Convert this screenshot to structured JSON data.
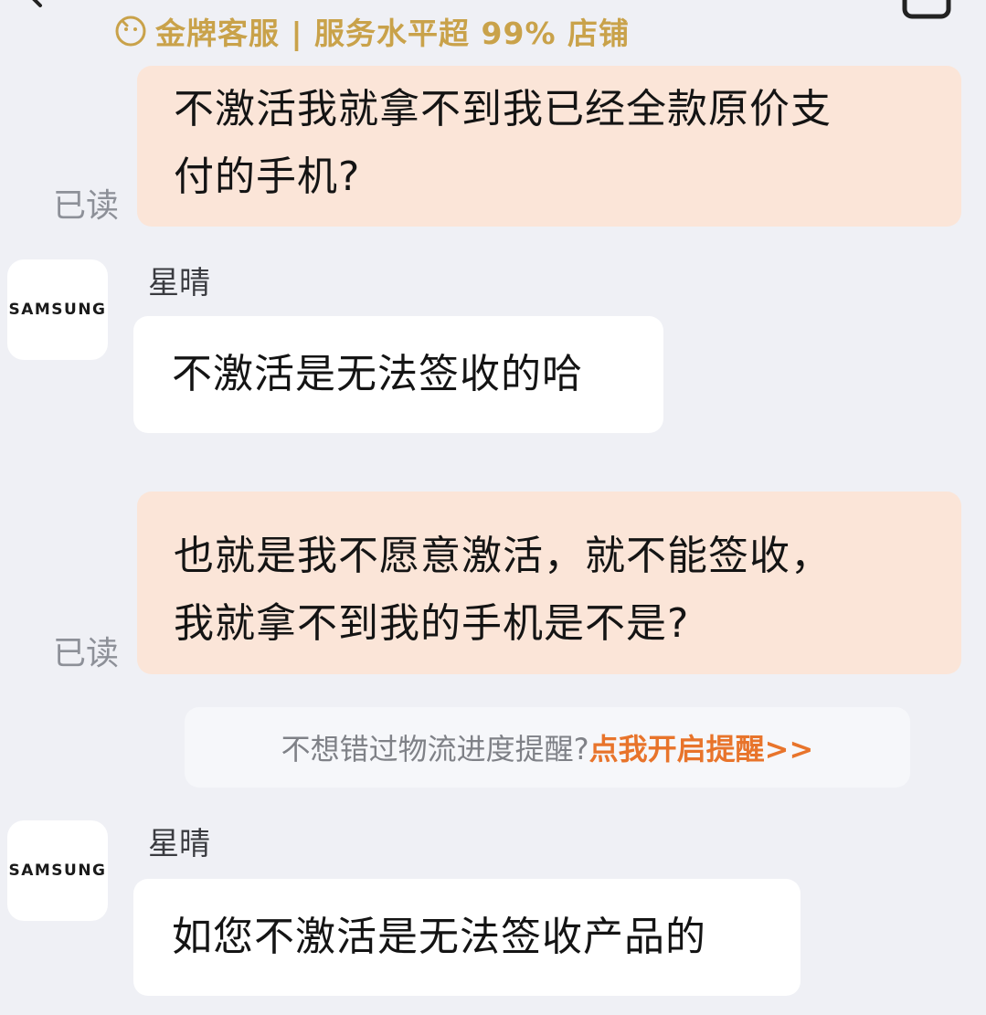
{
  "header": {
    "badge_text": "金牌客服 | 服务水平超 99% 店铺",
    "back_icon": "chevron-left-icon",
    "right_icon": "square-icon",
    "badge_icon": "smile-coin-icon",
    "badge_color": "#c9a24a"
  },
  "messages": [
    {
      "direction": "outgoing",
      "text": "不激活我就拿不到我已经全款原价支\n付的手机?",
      "status": "已读"
    },
    {
      "direction": "incoming",
      "sender": "星晴",
      "avatar_text": "SAMSUNG",
      "text": "不激活是无法签收的哈"
    },
    {
      "direction": "outgoing",
      "text": "也就是我不愿意激活，就不能签收，\n我就拿不到我的手机是不是?",
      "status": "已读"
    },
    {
      "direction": "incoming",
      "sender": "星晴",
      "avatar_text": "SAMSUNG",
      "text": "如您不激活是无法签收产品的"
    }
  ],
  "system_notice": {
    "text": "不想错过物流进度提醒? ",
    "link_text": "点我开启提醒>>",
    "link_color": "#e8742b"
  },
  "colors": {
    "background": "#eff0f5",
    "outgoing_bubble": "#fbe5d8",
    "incoming_bubble": "#ffffff",
    "read_receipt": "#8d9098"
  }
}
